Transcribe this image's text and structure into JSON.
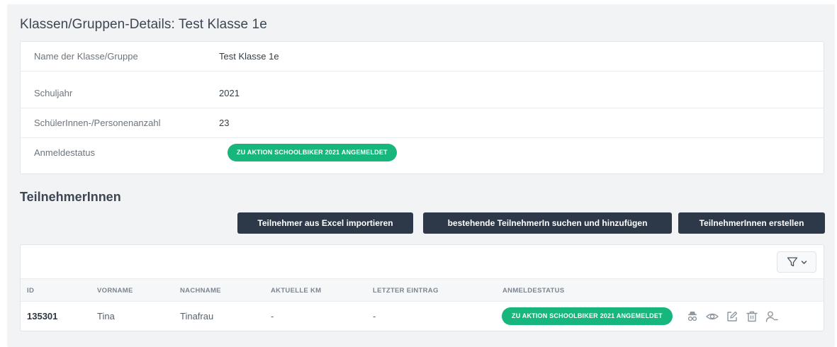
{
  "page": {
    "title": "Klassen/Gruppen-Details: Test Klasse 1e"
  },
  "details": {
    "rows": [
      {
        "label": "Name der Klasse/Gruppe",
        "value": "Test Klasse 1e"
      },
      {
        "label": "Schuljahr",
        "value": "2021"
      },
      {
        "label": "SchülerInnen-/Personenanzahl",
        "value": "23"
      },
      {
        "label": "Anmeldestatus",
        "badge": "ZU AKTION SCHOOLBIKER 2021 ANGEMELDET"
      }
    ]
  },
  "participants": {
    "title": "TeilnehmerInnen",
    "buttons": {
      "import_excel": "Teilnehmer aus Excel importieren",
      "search_add": "bestehende TeilnehmerIn suchen und hinzufügen",
      "create": "TeilnehmerInnen erstellen"
    },
    "columns": {
      "id": "ID",
      "first_name": "VORNAME",
      "last_name": "NACHNAME",
      "current_km": "AKTUELLE KM",
      "last_entry": "LETZTER EINTRAG",
      "status": "ANMELDESTATUS"
    },
    "rows": [
      {
        "id": "135301",
        "first_name": "Tina",
        "last_name": "Tinafrau",
        "current_km": "-",
        "last_entry": "-",
        "status": "ZU AKTION SCHOOLBIKER 2021 ANGEMELDET"
      }
    ],
    "row_action_icons": [
      "incognito-icon",
      "eye-icon",
      "edit-icon",
      "trash-icon",
      "user-remove-icon"
    ],
    "filter_icons": [
      "filter-icon",
      "chevron-down-icon"
    ]
  },
  "colors": {
    "badge_green": "#16b67c",
    "button_dark": "#2d3848",
    "panel_bg": "#f1f3f5"
  }
}
